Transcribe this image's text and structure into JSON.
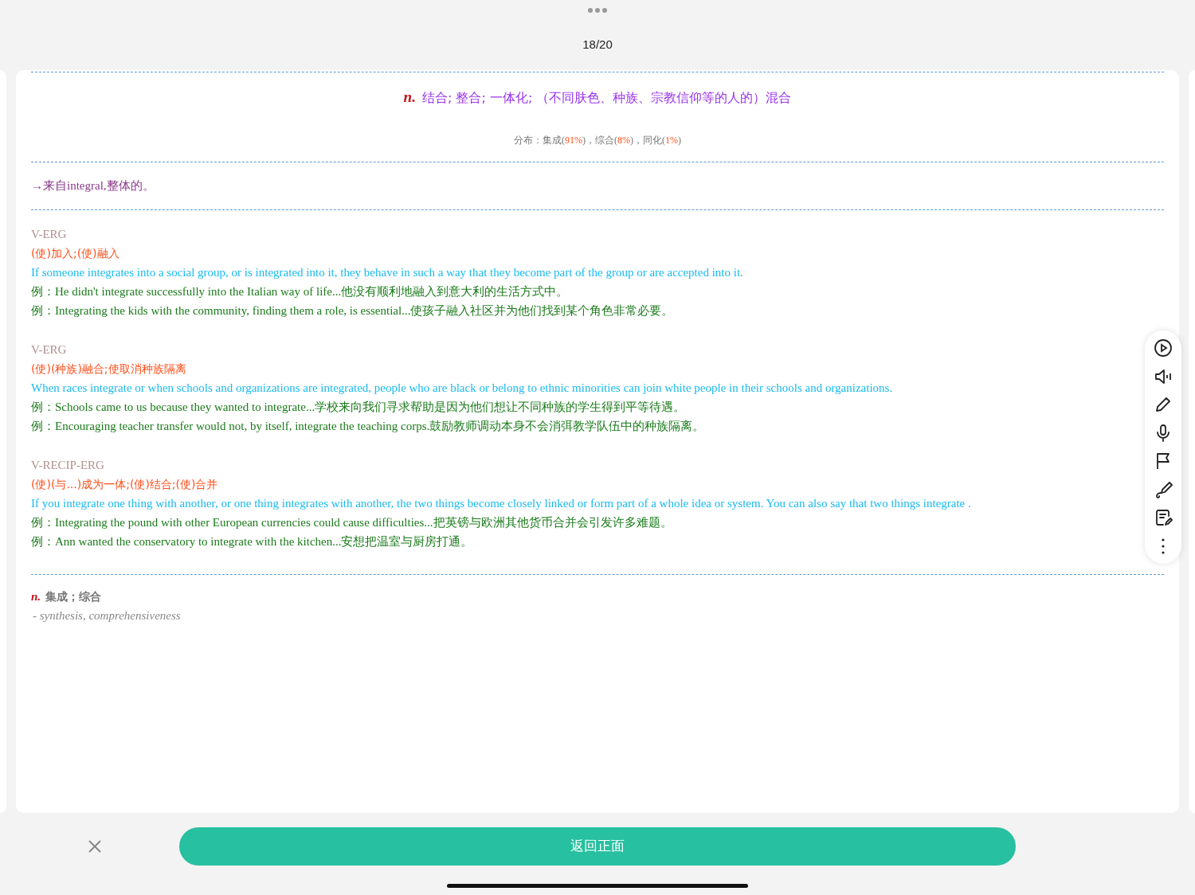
{
  "counter": "18/20",
  "headword": {
    "pos": "n.",
    "meaning": "结合; 整合; 一体化; （不同肤色、种族、宗教信仰等的人的）混合"
  },
  "distribution": [
    {
      "text": "分布：集成(",
      "highlight": false
    },
    {
      "text": "91%",
      "highlight": true
    },
    {
      "text": ")，综合(",
      "highlight": false
    },
    {
      "text": "8%",
      "highlight": true
    },
    {
      "text": ")，同化(",
      "highlight": false
    },
    {
      "text": "1%",
      "highlight": true
    },
    {
      "text": ")",
      "highlight": false
    }
  ],
  "etymology": "→来自integral,整体的。",
  "senses": [
    {
      "pattern": "V-ERG",
      "cn": "(使)加入;(使)融入",
      "en": "If someone integrates into a social group, or is integrated into it, they behave in such a way that they become part of the group or are accepted into it.",
      "examples": [
        "例：He didn't integrate successfully into the Italian way of life...他没有顺利地融入到意大利的生活方式中。",
        "例：Integrating the kids with the community, finding them a role, is essential...使孩子融入社区并为他们找到某个角色非常必要。"
      ]
    },
    {
      "pattern": "V-ERG",
      "cn": "(使)(种族)融合;使取消种族隔离",
      "en": "When races integrate or when schools and organizations are integrated, people who are black or belong to ethnic minorities can join white people in their schools and organizations.",
      "examples": [
        "例：Schools came to us because they wanted to integrate...学校来向我们寻求帮助是因为他们想让不同种族的学生得到平等待遇。",
        "例：Encouraging teacher transfer would not, by itself, integrate the teaching corps.鼓励教师调动本身不会消弭教学队伍中的种族隔离。"
      ]
    },
    {
      "pattern": "V-RECIP-ERG",
      "cn": "(使)(与...)成为一体;(使)结合;(使)合并",
      "en": "If you integrate one thing with another, or one thing integrates with another, the two things become closely linked or form part of a whole idea or system. You can also say that two things integrate .",
      "examples": [
        "例：Integrating the pound with other European currencies could cause difficulties...把英镑与欧洲其他货币合并会引发许多难题。",
        "例：Ann wanted the conservatory to integrate with the kitchen...安想把温室与厨房打通。"
      ]
    }
  ],
  "synonyms": {
    "pos": "n.",
    "meaning": "集成；综合",
    "english": "- synthesis, comprehensiveness"
  },
  "toolbar": [
    {
      "kind": "play"
    },
    {
      "kind": "speaker"
    },
    {
      "kind": "pencil"
    },
    {
      "kind": "mic"
    },
    {
      "kind": "flag"
    },
    {
      "kind": "pen"
    },
    {
      "kind": "note"
    },
    {
      "kind": "more"
    }
  ],
  "back_button": "返回正面"
}
